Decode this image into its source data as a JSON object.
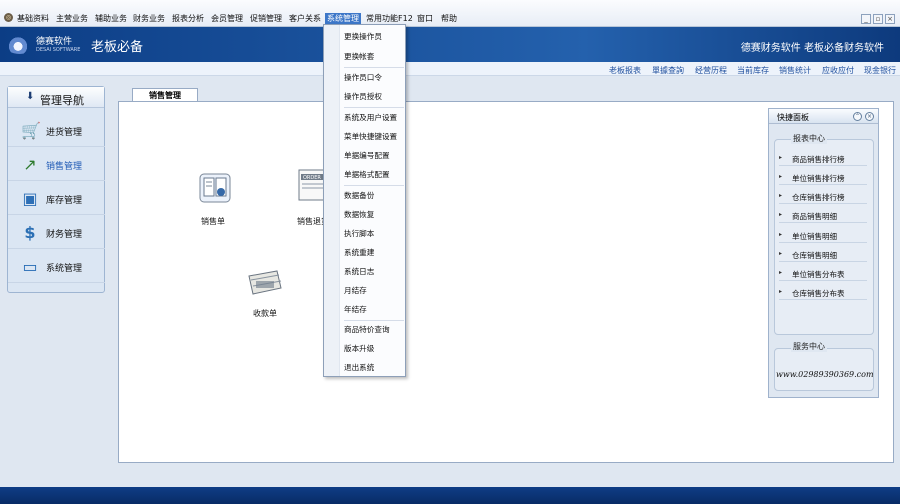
{
  "menu": {
    "items": [
      "基础资料",
      "主营业务",
      "辅助业务",
      "财务业务",
      "报表分析",
      "会员管理",
      "促销管理",
      "客户关系",
      "系统管理",
      "常用功能F12",
      "窗口",
      "帮助"
    ],
    "active_index": 8
  },
  "window_controls": [
    "_",
    "▫",
    "×"
  ],
  "banner": {
    "logo_cn": "德赛软件",
    "logo_en": "DESAI SOFTWARE",
    "slogan": "老板必备",
    "right_text": "德赛财务软件 老板必备财务软件"
  },
  "quicklinks": [
    "老板报表",
    "單據查詢",
    "经营历程",
    "当前库存",
    "销售统计",
    "应收应付",
    "现金银行"
  ],
  "nav": {
    "title": "管理导航",
    "items": [
      {
        "label": "进货管理",
        "icon": "cart-icon"
      },
      {
        "label": "销售管理",
        "icon": "chart-icon",
        "active": true
      },
      {
        "label": "库存管理",
        "icon": "box-icon"
      },
      {
        "label": "财务管理",
        "icon": "dollar-icon"
      },
      {
        "label": "系统管理",
        "icon": "monitor-icon"
      }
    ]
  },
  "main": {
    "tab": "销售管理",
    "shortcuts": [
      {
        "label": "销售单",
        "icon": "document-icon"
      },
      {
        "label": "销售退货",
        "icon": "order-icon"
      },
      {
        "label": "收款单",
        "icon": "money-icon"
      }
    ]
  },
  "shortcut_panel": {
    "title": "快捷面板",
    "report_heading": "报表中心",
    "report_items": [
      "商品销售排行榜",
      "单位销售排行榜",
      "仓库销售排行榜",
      "商品销售明细",
      "单位销售明细",
      "仓库销售明细",
      "单位销售分布表",
      "仓库销售分布表"
    ],
    "contact_heading": "服务中心",
    "contact_text": "www.02989390369.com"
  },
  "dropdown": {
    "items": [
      "更换操作员",
      "更换帐套",
      "操作员口令",
      "操作员授权",
      "系统及用户设置",
      "菜单快捷键设置",
      "单据编号配置",
      "单据格式配置",
      "数据备份",
      "数据恢复",
      "执行脚本",
      "系统重建",
      "系统日志",
      "月结存",
      "年结存",
      "商品特价查询",
      "版本升级",
      "退出系统"
    ]
  },
  "colors": {
    "accent": "#3d77c8",
    "banner": "#0c3d85",
    "link": "#1f4f9e"
  }
}
